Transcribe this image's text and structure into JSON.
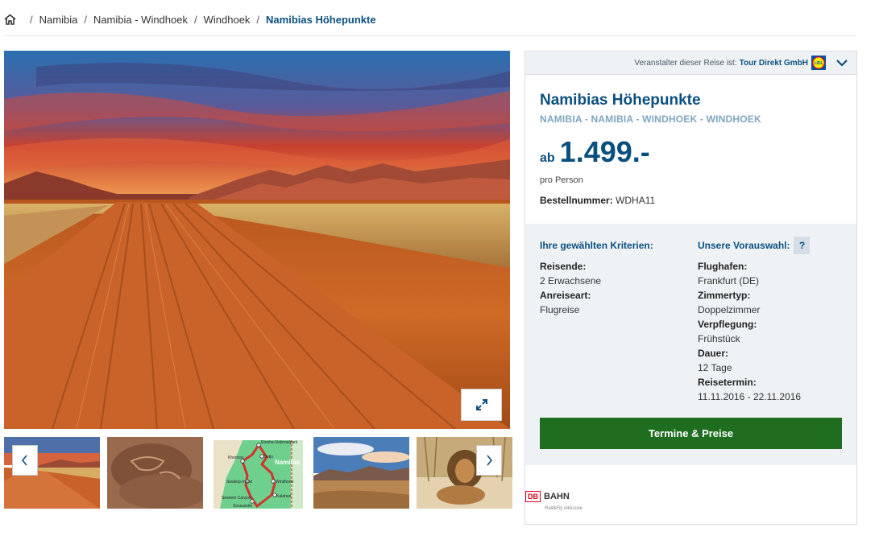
{
  "breadcrumb": {
    "items": [
      "Namibia",
      "Namibia - Windhoek",
      "Windhoek"
    ],
    "current": "Namibias Höhepunkte"
  },
  "gallery": {
    "thumbnails": [
      "Sandpiste",
      "Felsgravur",
      "Karte",
      "Landschaft",
      "Löwe"
    ]
  },
  "map_labels": {
    "country": "Namibia",
    "etosha": "Etosha-Nationalpark",
    "outjo": "Outjo",
    "khorixas": "Khorixas",
    "swakopmund": "Swakop-mund",
    "windhoek": "Windhoek",
    "kalahari": "Kalahari",
    "sesriem": "Sesriem Canyon",
    "sossusvlei": "Sossusvlei"
  },
  "panel": {
    "operator_label": "Veranstalter dieser Reise ist:",
    "operator_name": "Tour Direkt GmbH",
    "lidl_logo_text": "LIDL",
    "title": "Namibias Höhepunkte",
    "subtitle": "NAMIBIA - NAMIBIA - WINDHOEK - WINDHOEK",
    "price_prefix": "ab",
    "price": "1.499.-",
    "price_unit": "pro Person",
    "order_label": "Bestellnummer:",
    "order_number": "WDHA11"
  },
  "criteria": {
    "left_heading": "Ihre gewählten Kriterien:",
    "right_heading": "Unsere Vorauswahl:",
    "help": "?",
    "left": [
      {
        "label": "Reisende:",
        "value": "2 Erwachsene"
      },
      {
        "label": "Anreiseart:",
        "value": "Flugreise"
      }
    ],
    "right": [
      {
        "label": "Flughafen:",
        "value": "Frankfurt (DE)"
      },
      {
        "label": "Zimmertyp:",
        "value": "Doppelzimmer"
      },
      {
        "label": "Verpflegung:",
        "value": "Frühstück"
      },
      {
        "label": "Dauer:",
        "value": "12 Tage"
      },
      {
        "label": "Reisetermin:",
        "value": "11.11.2016 - 22.11.2016"
      }
    ]
  },
  "cta_label": "Termine & Preise",
  "bahn": {
    "logo": "DB",
    "name": "BAHN",
    "tagline": "Rail&Fly inklusive"
  },
  "colors": {
    "brand_blue": "#0b4f7f",
    "cta_green": "#1f6e20",
    "panel_bg": "#eef2f5"
  },
  "icons": [
    "home-icon",
    "expand-icon",
    "chevron-left-icon",
    "chevron-right-icon",
    "chevron-down-icon",
    "lidl-logo"
  ]
}
